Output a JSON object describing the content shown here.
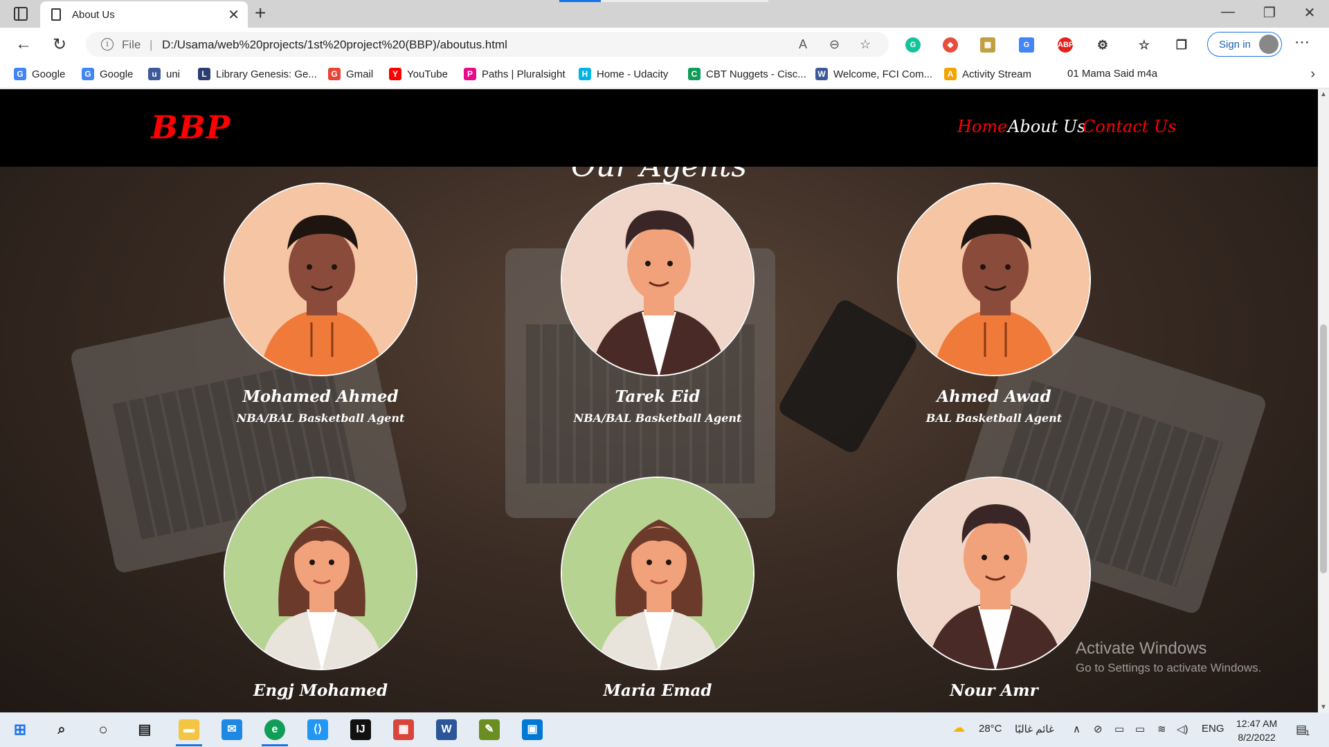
{
  "browser": {
    "tab_title": "About Us",
    "file_label": "File",
    "separator": "|",
    "url": "D:/Usama/web%20projects/1st%20project%20(BBP)/aboutus.html",
    "signin_label": "Sign in",
    "page_load_progress": 0.2,
    "bookmarks": [
      {
        "label": "Google",
        "icon": "google-icon",
        "color": "#4285f4"
      },
      {
        "label": "Google",
        "icon": "google-icon",
        "color": "#4285f4"
      },
      {
        "label": "uni",
        "icon": "university-icon",
        "color": "#3c5a99"
      },
      {
        "label": "Library Genesis: Ge...",
        "icon": "library-icon",
        "color": "#2c3e70"
      },
      {
        "label": "Gmail",
        "icon": "gmail-icon",
        "color": "#ea4335"
      },
      {
        "label": "YouTube",
        "icon": "youtube-icon",
        "color": "#ff0000"
      },
      {
        "label": "Paths | Pluralsight",
        "icon": "pluralsight-icon",
        "color": "#e80a89"
      },
      {
        "label": "Home - Udacity",
        "icon": "udacity-icon",
        "color": "#02b3e4"
      },
      {
        "label": "CBT Nuggets - Cisc...",
        "icon": "drive-icon",
        "color": "#0f9d58"
      },
      {
        "label": "Welcome, FCI Com...",
        "icon": "fci-icon",
        "color": "#3c5a99"
      },
      {
        "label": "Activity Stream",
        "icon": "activity-icon",
        "color": "#f4a300"
      },
      {
        "label": "01 Mama Said m4a",
        "icon": "",
        "color": ""
      }
    ]
  },
  "site": {
    "logo": "BBP",
    "nav": [
      {
        "label": "Home",
        "color": "#ff0000"
      },
      {
        "label": "About Us",
        "color": "#ffffff"
      },
      {
        "label": "Contact Us",
        "color": "#ff0000"
      }
    ],
    "section_title": "Our Agents",
    "agents": [
      {
        "name": "Mohamed Ahmed",
        "role": "NBA/BAL Basketball Agent",
        "avatar": "man-orange-hoodie",
        "bg": "#f6c6a4"
      },
      {
        "name": "Tarek Eid",
        "role": "NBA/BAL Basketball Agent",
        "avatar": "man-dark-jacket",
        "bg": "#efd6c8"
      },
      {
        "name": "Ahmed Awad",
        "role": "BAL Basketball Agent",
        "avatar": "man-orange-hoodie",
        "bg": "#f6c6a4"
      },
      {
        "name": "Engj Mohamed",
        "role": "",
        "avatar": "woman-white-blazer",
        "bg": "#b7d392"
      },
      {
        "name": "Maria Emad",
        "role": "",
        "avatar": "woman-white-blazer",
        "bg": "#b7d392"
      },
      {
        "name": "Nour Amr",
        "role": "",
        "avatar": "man-dark-jacket",
        "bg": "#efd6c8"
      }
    ]
  },
  "watermark": {
    "line1": "Activate Windows",
    "line2": "Go to Settings to activate Windows."
  },
  "taskbar": {
    "weather_temp": "28°C",
    "weather_desc": "غائم غالبًا",
    "language": "ENG",
    "time": "12:47 AM",
    "date": "8/2/2022",
    "notification_count": "1"
  }
}
